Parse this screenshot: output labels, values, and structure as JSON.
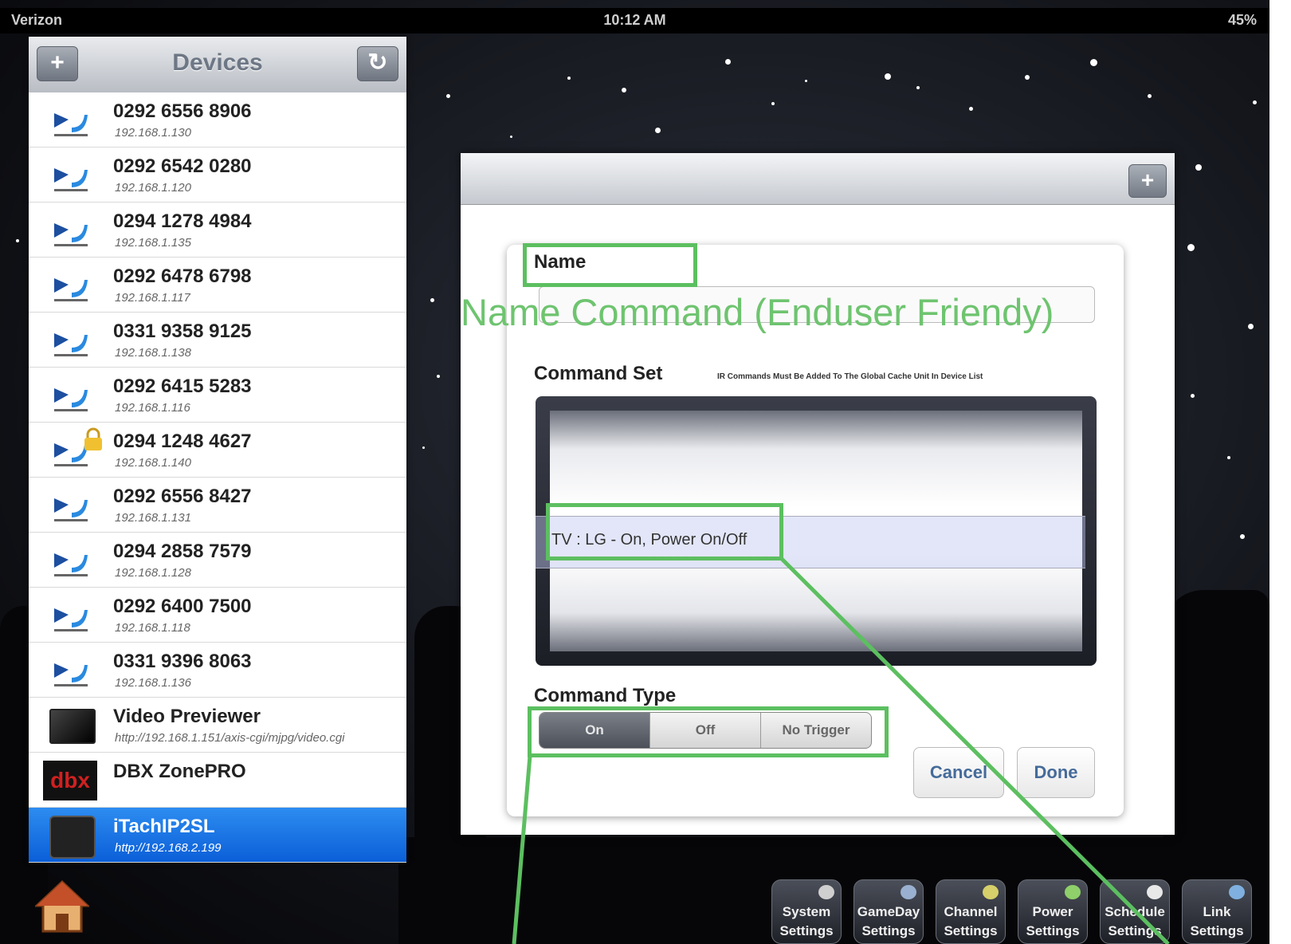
{
  "status_bar": {
    "carrier": "Verizon",
    "time": "10:12 AM",
    "battery": "45%"
  },
  "devices": {
    "title": "Devices",
    "add_label": "+",
    "refresh_label": "↻",
    "items": [
      {
        "name": "0292 6556 8906",
        "ip": "192.168.1.130",
        "icon": "directv-icon"
      },
      {
        "name": "0292 6542 0280",
        "ip": "192.168.1.120",
        "icon": "directv-icon"
      },
      {
        "name": "0294 1278 4984",
        "ip": "192.168.1.135",
        "icon": "directv-icon"
      },
      {
        "name": "0292 6478 6798",
        "ip": "192.168.1.117",
        "icon": "directv-icon"
      },
      {
        "name": "0331 9358 9125",
        "ip": "192.168.1.138",
        "icon": "directv-icon"
      },
      {
        "name": "0292 6415 5283",
        "ip": "192.168.1.116",
        "icon": "directv-icon"
      },
      {
        "name": "0294 1248 4627",
        "ip": "192.168.1.140",
        "icon": "directv-locked-icon"
      },
      {
        "name": "0292 6556 8427",
        "ip": "192.168.1.131",
        "icon": "directv-icon"
      },
      {
        "name": "0294 2858 7579",
        "ip": "192.168.1.128",
        "icon": "directv-icon"
      },
      {
        "name": "0292 6400 7500",
        "ip": "192.168.1.118",
        "icon": "directv-icon"
      },
      {
        "name": "0331 9396 8063",
        "ip": "192.168.1.136",
        "icon": "directv-icon"
      },
      {
        "name": "Video Previewer",
        "ip": "http://192.168.1.151/axis-cgi/mjpg/video.cgi",
        "icon": "tv-icon"
      },
      {
        "name": "DBX ZonePRO",
        "ip": "",
        "icon": "dbx-icon"
      },
      {
        "name": "iTachIP2SL",
        "ip": "http://192.168.2.199",
        "icon": "itach-icon",
        "selected": true
      }
    ]
  },
  "modal": {
    "add_label": "+",
    "name_label": "Name",
    "name_value": "",
    "command_set_label": "Command Set",
    "command_set_note": "IR Commands Must Be Added To The Global Cache Unit In Device List",
    "picker_selected": "TV : LG - On, Power On/Off",
    "command_type_label": "Command Type",
    "command_types": [
      "On",
      "Off",
      "No Trigger"
    ],
    "command_type_selected": "On",
    "cancel_label": "Cancel",
    "done_label": "Done"
  },
  "toolbar": {
    "home_icon": "home-icon",
    "buttons": [
      {
        "line1": "System",
        "line2": "Settings",
        "icon": "tools-icon"
      },
      {
        "line1": "GameDay",
        "line2": "Settings",
        "icon": "calendar-icon"
      },
      {
        "line1": "Channel",
        "line2": "Settings",
        "icon": "chat-icon"
      },
      {
        "line1": "Power",
        "line2": "Settings",
        "icon": "power-icon"
      },
      {
        "line1": "Schedule",
        "line2": "Settings",
        "icon": "clock-icon"
      },
      {
        "line1": "Link",
        "line2": "Settings",
        "icon": "link-icon"
      }
    ]
  },
  "annotation": {
    "text": "Name Command (Enduser Friendy)",
    "color": "#5cbf60"
  }
}
